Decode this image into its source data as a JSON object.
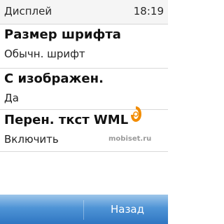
{
  "status_bar": {
    "title": "Дисплей",
    "time": "18:19"
  },
  "settings": [
    {
      "label": "Размер шрифта",
      "value": "Обычн. шрифт"
    },
    {
      "label": "С изображен.",
      "value": "Да"
    },
    {
      "label": "Перен. ткст WML",
      "value": "Включить"
    }
  ],
  "watermark": {
    "text": "mobiset.ru",
    "icon": "mobiset-logo-icon",
    "color": "#f28c00"
  },
  "softkeys": {
    "right_label": "Назад"
  },
  "colors": {
    "softkey_top": "#9ec6ea",
    "softkey_bottom": "#2f76c2",
    "divider": "#d9d9d9"
  }
}
